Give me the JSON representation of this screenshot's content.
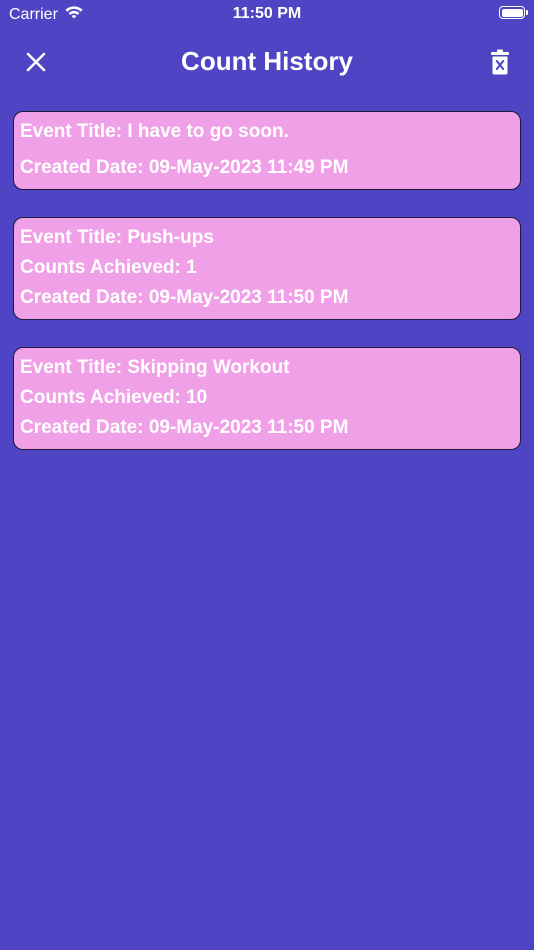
{
  "status_bar": {
    "carrier": "Carrier",
    "time": "11:50 PM"
  },
  "nav": {
    "title": "Count History",
    "close_icon": "close-icon",
    "trash_icon": "trash-icon"
  },
  "colors": {
    "background": "#4f44c4",
    "card": "#f0a0e6",
    "text": "#ffffff"
  },
  "history": [
    {
      "event_title": "Event Title: I have to go soon.",
      "created_date": "Created Date: 09-May-2023 11:49 PM"
    },
    {
      "event_title": "Event Title: Push-ups",
      "counts_achieved": "Counts Achieved: 1",
      "created_date": "Created Date: 09-May-2023 11:50 PM"
    },
    {
      "event_title": "Event Title: Skipping Workout",
      "counts_achieved": "Counts Achieved: 10",
      "created_date": "Created Date: 09-May-2023 11:50 PM"
    }
  ]
}
